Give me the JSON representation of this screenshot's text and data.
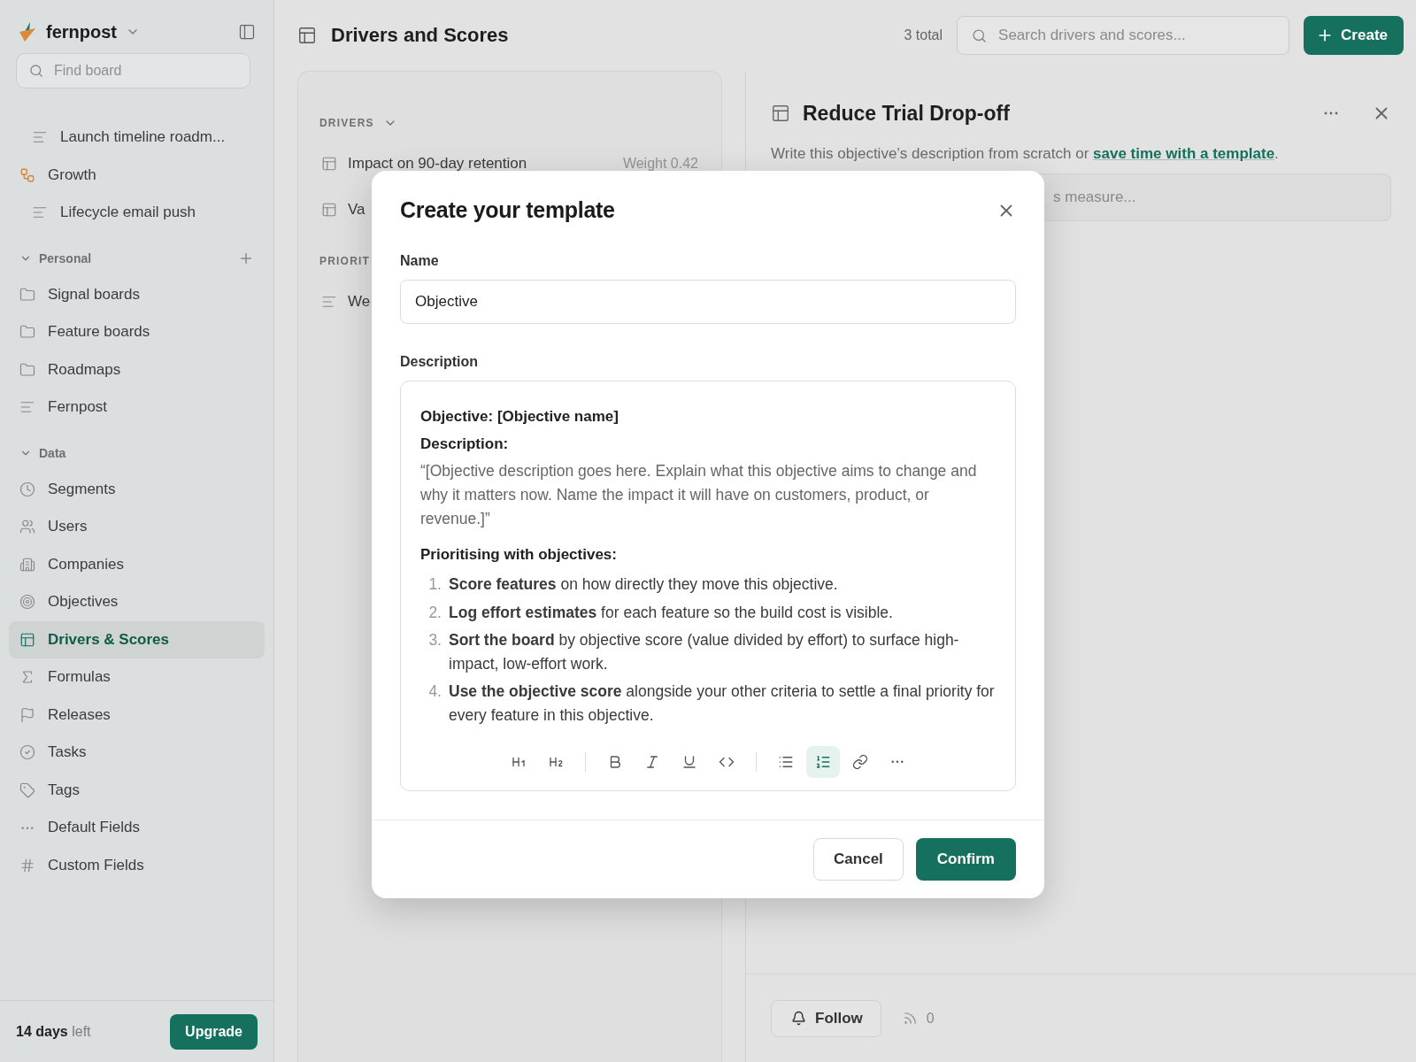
{
  "workspace": {
    "name": "fernpost"
  },
  "sidebar": {
    "search": {
      "placeholder": "Find board"
    },
    "boards": [
      {
        "kind": "list",
        "label": "Launch timeline roadm..."
      },
      {
        "kind": "group",
        "label": "Growth",
        "children": [
          {
            "kind": "list",
            "label": "Lifecycle email push"
          }
        ]
      }
    ],
    "sections": [
      {
        "title": "Personal",
        "expanded": true,
        "addable": true,
        "items": [
          {
            "kind": "folder",
            "label": "Signal boards",
            "selected": false
          },
          {
            "kind": "folder",
            "label": "Feature boards",
            "selected": false
          },
          {
            "kind": "folder",
            "label": "Roadmaps",
            "selected": false
          },
          {
            "kind": "list",
            "label": "Fernpost",
            "selected": false
          }
        ]
      },
      {
        "title": "Data",
        "expanded": true,
        "addable": false,
        "items": [
          {
            "kind": "clock",
            "label": "Segments",
            "selected": false
          },
          {
            "kind": "users",
            "label": "Users",
            "selected": false
          },
          {
            "kind": "building",
            "label": "Companies",
            "selected": false
          },
          {
            "kind": "target",
            "label": "Objectives",
            "selected": false
          },
          {
            "kind": "table",
            "label": "Drivers & Scores",
            "selected": true
          },
          {
            "kind": "sigma",
            "label": "Formulas",
            "selected": false
          },
          {
            "kind": "flag",
            "label": "Releases",
            "selected": false
          },
          {
            "kind": "check",
            "label": "Tasks",
            "selected": false
          },
          {
            "kind": "tag",
            "label": "Tags",
            "selected": false
          },
          {
            "kind": "dots",
            "label": "Default Fields",
            "selected": false
          },
          {
            "kind": "hash",
            "label": "Custom Fields",
            "selected": false
          }
        ]
      }
    ],
    "trial": {
      "days": "14 days",
      "suffix": "left",
      "button": "Upgrade"
    }
  },
  "header": {
    "title": "Drivers and Scores",
    "count": "3 total",
    "search": {
      "placeholder": "Search drivers and scores..."
    },
    "create": "Create"
  },
  "list_panel": {
    "groups": [
      {
        "title": "DRIVERS",
        "collapsible": true,
        "items": [
          {
            "kind": "table",
            "label": "Impact on 90-day retention",
            "weight": "Weight 0.42"
          },
          {
            "kind": "table",
            "label": "Va"
          }
        ]
      },
      {
        "title": "PRIORIT",
        "collapsible": false,
        "items": [
          {
            "kind": "list",
            "label": "We"
          }
        ]
      }
    ]
  },
  "detail": {
    "title": "Reduce Trial Drop-off",
    "intro": "Write this objective’s description from scratch or ",
    "link": "save time with a template",
    "intro_end": ".",
    "field": {
      "placeholder": "s measure..."
    },
    "follow": "Follow",
    "followers": "0"
  },
  "modal": {
    "title": "Create your template",
    "name_label": "Name",
    "name_value": "Objective",
    "description_label": "Description",
    "content": [
      {
        "kind": "bold",
        "text": "Objective: [Objective name]"
      },
      {
        "kind": "bold",
        "text": "Description:"
      },
      {
        "kind": "quote",
        "text": "“[Objective description goes here. Explain what this objective aims to change and why it matters now. Name the impact it will have on customers, product, or revenue.]”"
      },
      {
        "kind": "heading",
        "text": "Prioritising with objectives:"
      },
      {
        "kind": "ordered",
        "items": [
          {
            "number": "1.",
            "text": "**Score features** on how directly they move this objective."
          },
          {
            "number": "2.",
            "text": "**Log effort estimates** for each feature so the build cost is visible."
          },
          {
            "number": "3.",
            "text": "**Sort the board** by objective score (value divided by effort) to surface high-impact, low-effort work."
          },
          {
            "number": "4.",
            "text": "**Use the objective score** alongside your other criteria to settle a final priority for every feature in this objective."
          }
        ]
      }
    ],
    "toolbar": [
      {
        "kind": "h1",
        "selected": false
      },
      {
        "kind": "h2",
        "selected": false
      },
      {
        "kind": "separator"
      },
      {
        "kind": "bold",
        "selected": false
      },
      {
        "kind": "italic",
        "selected": false
      },
      {
        "kind": "underline",
        "selected": false
      },
      {
        "kind": "code",
        "selected": false
      },
      {
        "kind": "separator"
      },
      {
        "kind": "bullets",
        "selected": false
      },
      {
        "kind": "numbered",
        "selected": true
      },
      {
        "kind": "link",
        "selected": false
      },
      {
        "kind": "more",
        "selected": false
      }
    ],
    "cancel": "Cancel",
    "confirm": "Confirm"
  }
}
